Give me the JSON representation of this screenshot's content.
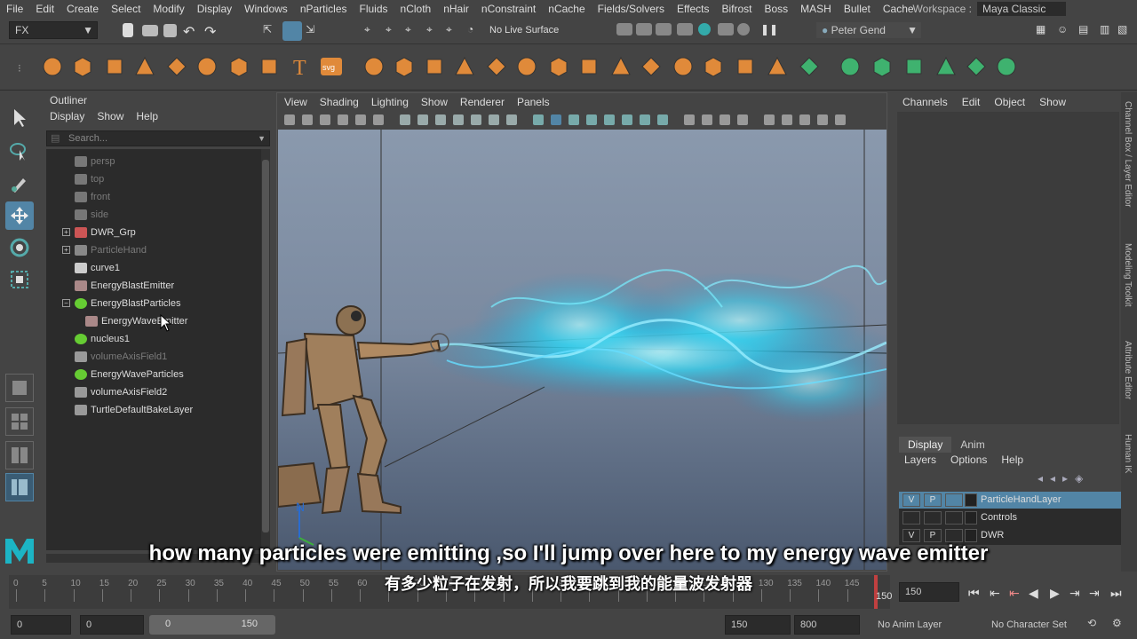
{
  "menubar": {
    "items": [
      "File",
      "Edit",
      "Create",
      "Select",
      "Modify",
      "Display",
      "Windows",
      "nParticles",
      "Fluids",
      "nCloth",
      "nHair",
      "nConstraint",
      "nCache",
      "Fields/Solvers",
      "Effects",
      "Bifrost",
      "Boss",
      "MASH",
      "Bullet",
      "Cache"
    ],
    "workspace_label": "Workspace :",
    "workspace_value": "Maya Classic"
  },
  "statusline": {
    "menuset": "FX",
    "live_surface": "No Live Surface",
    "user": "Peter Gend"
  },
  "shelf": {
    "icons": [
      "sphere-icon",
      "cube-icon",
      "cylinder-icon",
      "cone-icon",
      "plane-icon",
      "torus-icon",
      "pyramid-icon",
      "pipe-icon",
      "text-icon",
      "svg-icon",
      "poly-a-icon",
      "poly-b-icon",
      "poly-c-icon",
      "poly-d-icon",
      "poly-e-icon",
      "poly-f-icon",
      "poly-g-icon",
      "poly-h-icon",
      "poly-i-icon",
      "poly-j-icon",
      "poly-k-icon",
      "poly-l-icon",
      "poly-m-icon",
      "poly-n-icon",
      "green-a-icon",
      "green-b-icon",
      "green-c-icon",
      "green-d-icon",
      "green-e-icon",
      "green-f-icon",
      "green-g-icon"
    ],
    "svg_label": "svg"
  },
  "outliner": {
    "title": "Outliner",
    "menu": [
      "Display",
      "Show",
      "Help"
    ],
    "search_placeholder": "Search...",
    "items": [
      {
        "label": "persp",
        "dim": true,
        "icon": "camera-icon",
        "indent": 1
      },
      {
        "label": "top",
        "dim": true,
        "icon": "camera-icon",
        "indent": 1
      },
      {
        "label": "front",
        "dim": true,
        "icon": "camera-icon",
        "indent": 1
      },
      {
        "label": "side",
        "dim": true,
        "icon": "camera-icon",
        "indent": 1
      },
      {
        "label": "DWR_Grp",
        "dim": false,
        "icon": "group-icon",
        "indent": 1,
        "expander": "+"
      },
      {
        "label": "ParticleHand",
        "dim": true,
        "icon": "particle-hand-icon",
        "indent": 1,
        "expander": "+"
      },
      {
        "label": "curve1",
        "dim": false,
        "icon": "curve-icon",
        "indent": 1
      },
      {
        "label": "EnergyBlastEmitter",
        "dim": false,
        "icon": "emitter-icon",
        "indent": 1
      },
      {
        "label": "EnergyBlastParticles",
        "dim": false,
        "icon": "nparticle-icon",
        "indent": 1,
        "expander": "−"
      },
      {
        "label": "EnergyWaveEmitter",
        "dim": false,
        "icon": "emitter-icon",
        "indent": 2
      },
      {
        "label": "nucleus1",
        "dim": false,
        "icon": "nucleus-icon",
        "indent": 1
      },
      {
        "label": "volumeAxisField1",
        "dim": true,
        "icon": "field-icon",
        "indent": 1
      },
      {
        "label": "EnergyWaveParticles",
        "dim": false,
        "icon": "nparticle-icon",
        "indent": 1
      },
      {
        "label": "volumeAxisField2",
        "dim": false,
        "icon": "field-icon",
        "indent": 1
      },
      {
        "label": "TurtleDefaultBakeLayer",
        "dim": false,
        "icon": "field-icon",
        "indent": 1
      }
    ]
  },
  "viewport": {
    "menu": [
      "View",
      "Shading",
      "Lighting",
      "Show",
      "Renderer",
      "Panels"
    ],
    "axis_label": "N"
  },
  "channelbox": {
    "menu": [
      "Channels",
      "Edit",
      "Object",
      "Show"
    ]
  },
  "layer_editor": {
    "tabs": [
      "Display",
      "Anim"
    ],
    "menu": [
      "Layers",
      "Options",
      "Help"
    ],
    "layers": [
      {
        "v": "V",
        "p": "P",
        "name": "ParticleHandLayer",
        "selected": true
      },
      {
        "v": "",
        "p": "",
        "name": "Controls",
        "selected": false
      },
      {
        "v": "V",
        "p": "P",
        "name": "DWR",
        "selected": false
      }
    ]
  },
  "side_tabs": [
    "Channel Box / Layer Editor",
    "Modeling Toolkit",
    "Attribute Editor",
    "Human IK"
  ],
  "timeslider": {
    "ticks": [
      "0",
      "5",
      "10",
      "15",
      "20",
      "25",
      "30",
      "35",
      "40",
      "45",
      "50",
      "55",
      "60",
      "65",
      "70",
      "75",
      "80",
      "85",
      "90",
      "95",
      "100",
      "105",
      "110",
      "115",
      "120",
      "125",
      "130",
      "135",
      "140",
      "145",
      "150"
    ],
    "current_frame": "150",
    "end_label": "150"
  },
  "rangeslider": {
    "start": "0",
    "playback_start": "0",
    "range_start": "0",
    "range_end": "150",
    "playback_end": "150",
    "anim_end": "800",
    "anim_layer": "No Anim Layer",
    "character_set": "No Character Set"
  },
  "subtitles": {
    "en": "how many particles were emitting ,so I'll jump over here to my energy wave emitter",
    "zh": "有多少粒子在发射，所以我要跳到我的能量波发射器"
  }
}
